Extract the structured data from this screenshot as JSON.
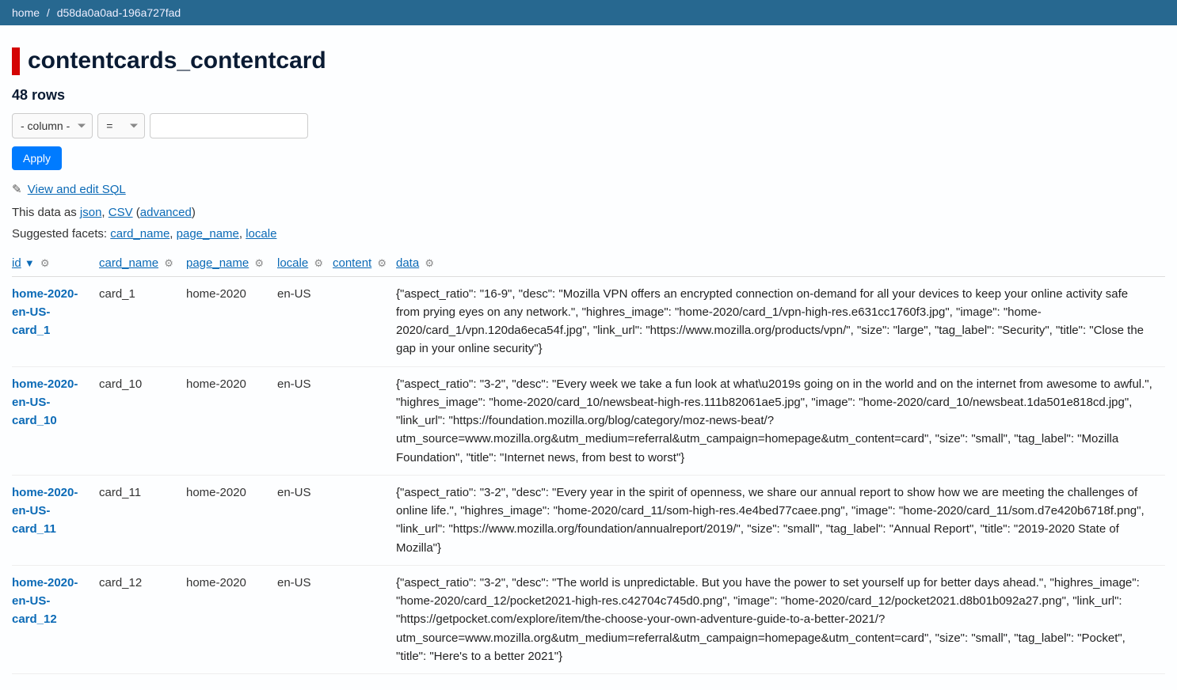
{
  "breadcrumb": {
    "home": "home",
    "db": "d58da0a0ad-196a727fad"
  },
  "page_title": "contentcards_contentcard",
  "row_count_label": "48 rows",
  "filter": {
    "column_placeholder": "- column -",
    "op_value": "=",
    "apply": "Apply"
  },
  "sql_link": "View and edit SQL",
  "data_as": {
    "prefix": "This data as ",
    "json": "json",
    "csv": "CSV",
    "advanced": "advanced"
  },
  "facets": {
    "prefix": "Suggested facets: ",
    "items": [
      "card_name",
      "page_name",
      "locale"
    ]
  },
  "columns": [
    {
      "label": "id",
      "sorted": true
    },
    {
      "label": "card_name"
    },
    {
      "label": "page_name"
    },
    {
      "label": "locale"
    },
    {
      "label": "content"
    },
    {
      "label": "data"
    }
  ],
  "sort_arrow": "▼",
  "rows": [
    {
      "id": "home-2020-en-US-card_1",
      "card_name": "card_1",
      "page_name": "home-2020",
      "locale": "en-US",
      "content": "",
      "data": "{\"aspect_ratio\": \"16-9\", \"desc\": \"Mozilla VPN offers an encrypted connection on-demand for all your devices to keep your online activity safe from prying eyes on any network.\", \"highres_image\": \"home-2020/card_1/vpn-high-res.e631cc1760f3.jpg\", \"image\": \"home-2020/card_1/vpn.120da6eca54f.jpg\", \"link_url\": \"https://www.mozilla.org/products/vpn/\", \"size\": \"large\", \"tag_label\": \"Security\", \"title\": \"Close the gap in your online security\"}"
    },
    {
      "id": "home-2020-en-US-card_10",
      "card_name": "card_10",
      "page_name": "home-2020",
      "locale": "en-US",
      "content": "",
      "data": "{\"aspect_ratio\": \"3-2\", \"desc\": \"Every week we take a fun look at what\\u2019s going on in the world and on the internet from awesome to awful.\", \"highres_image\": \"home-2020/card_10/newsbeat-high-res.111b82061ae5.jpg\", \"image\": \"home-2020/card_10/newsbeat.1da501e818cd.jpg\", \"link_url\": \"https://foundation.mozilla.org/blog/category/moz-news-beat/?utm_source=www.mozilla.org&utm_medium=referral&utm_campaign=homepage&utm_content=card\", \"size\": \"small\", \"tag_label\": \"Mozilla Foundation\", \"title\": \"Internet news, from best to worst\"}"
    },
    {
      "id": "home-2020-en-US-card_11",
      "card_name": "card_11",
      "page_name": "home-2020",
      "locale": "en-US",
      "content": "",
      "data": "{\"aspect_ratio\": \"3-2\", \"desc\": \"Every year in the spirit of openness, we share our annual report to show how we are meeting the challenges of online life.\", \"highres_image\": \"home-2020/card_11/som-high-res.4e4bed77caee.png\", \"image\": \"home-2020/card_11/som.d7e420b6718f.png\", \"link_url\": \"https://www.mozilla.org/foundation/annualreport/2019/\", \"size\": \"small\", \"tag_label\": \"Annual Report\", \"title\": \"2019-2020 State of Mozilla\"}"
    },
    {
      "id": "home-2020-en-US-card_12",
      "card_name": "card_12",
      "page_name": "home-2020",
      "locale": "en-US",
      "content": "",
      "data": "{\"aspect_ratio\": \"3-2\", \"desc\": \"The world is unpredictable. But you have the power to set yourself up for better days ahead.\", \"highres_image\": \"home-2020/card_12/pocket2021-high-res.c42704c745d0.png\", \"image\": \"home-2020/card_12/pocket2021.d8b01b092a27.png\", \"link_url\": \"https://getpocket.com/explore/item/the-choose-your-own-adventure-guide-to-a-better-2021/?utm_source=www.mozilla.org&utm_medium=referral&utm_campaign=homepage&utm_content=card\", \"size\": \"small\", \"tag_label\": \"Pocket\", \"title\": \"Here's to a better 2021\"}"
    }
  ]
}
